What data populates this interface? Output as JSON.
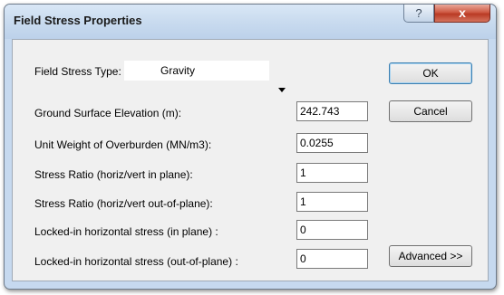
{
  "window": {
    "title": "Field Stress Properties",
    "help_glyph": "?",
    "close_glyph": "x"
  },
  "form": {
    "field_stress_type_label": "Field Stress Type:",
    "field_stress_type_value": "Gravity",
    "ground_surface_elevation_label": "Ground Surface Elevation (m):",
    "ground_surface_elevation_value": "242.743",
    "unit_weight_label": "Unit Weight of Overburden (MN/m3):",
    "unit_weight_value": "0.0255",
    "stress_ratio_in_plane_label": "Stress Ratio (horiz/vert in plane):",
    "stress_ratio_in_plane_value": "1",
    "stress_ratio_out_of_plane_label": "Stress Ratio (horiz/vert out-of-plane):",
    "stress_ratio_out_of_plane_value": "1",
    "locked_in_plane_label": "Locked-in horizontal stress (in plane) :",
    "locked_in_plane_value": "0",
    "locked_out_of_plane_label": "Locked-in horizontal stress (out-of-plane) :",
    "locked_out_of_plane_value": "0"
  },
  "buttons": {
    "ok": "OK",
    "cancel": "Cancel",
    "advanced": "Advanced >>"
  }
}
